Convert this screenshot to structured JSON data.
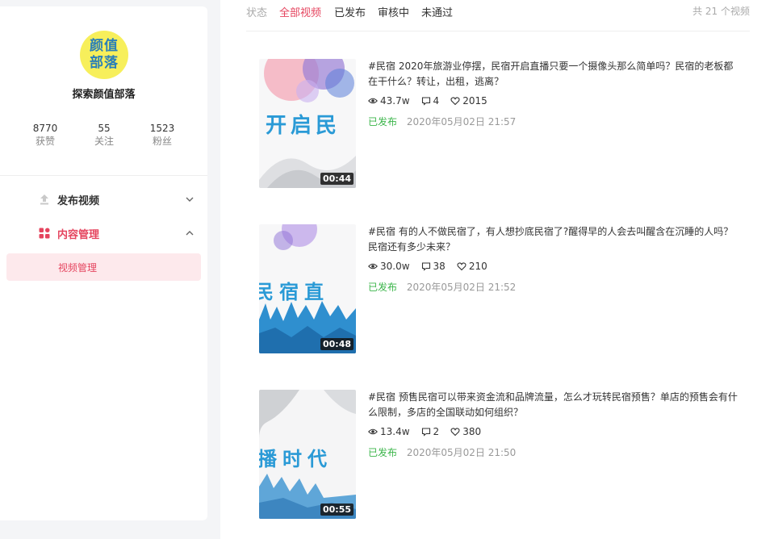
{
  "profile": {
    "avatar_line1": "颜值",
    "avatar_line2": "部落",
    "name": "探索颜值部落",
    "stats": [
      {
        "value": "8770",
        "label": "获赞"
      },
      {
        "value": "55",
        "label": "关注"
      },
      {
        "value": "1523",
        "label": "粉丝"
      }
    ]
  },
  "menu": {
    "publish_label": "发布视频",
    "manage_label": "内容管理",
    "sub_video_label": "视频管理"
  },
  "filters": {
    "label": "状态",
    "tabs": [
      "全部视频",
      "已发布",
      "审核中",
      "未通过"
    ],
    "active": "全部视频",
    "total": "共 21 个视频"
  },
  "videos": [
    {
      "title": "#民宿 2020年旅游业停摆，民宿开启直播只要一个摄像头那么简单吗？民宿的老板都在干什么？转让，出租，逃离？",
      "views": "43.7w",
      "comments": "4",
      "likes": "2015",
      "status": "已发布",
      "time": "2020年05月02日 21:57",
      "duration": "00:44",
      "thumb_text": "开启民"
    },
    {
      "title": "#民宿 有的人不做民宿了，有人想抄底民宿了?醒得早的人会去叫醒含在沉睡的人吗？民宿还有多少未来？",
      "views": "30.0w",
      "comments": "38",
      "likes": "210",
      "status": "已发布",
      "time": "2020年05月02日 21:52",
      "duration": "00:48",
      "thumb_text": "民宿直"
    },
    {
      "title": "#民宿 预售民宿可以带来资金流和品牌流量，怎么才玩转民宿预售？单店的预售会有什么限制，多店的全国联动如何组织？",
      "views": "13.4w",
      "comments": "2",
      "likes": "380",
      "status": "已发布",
      "time": "2020年05月02日 21:50",
      "duration": "00:55",
      "thumb_text": "播时代"
    }
  ],
  "colors": {
    "accent": "#e5455f",
    "published": "#3bb54a",
    "avatar_bg": "#f7ef5b",
    "avatar_text": "#2a7fb8"
  }
}
